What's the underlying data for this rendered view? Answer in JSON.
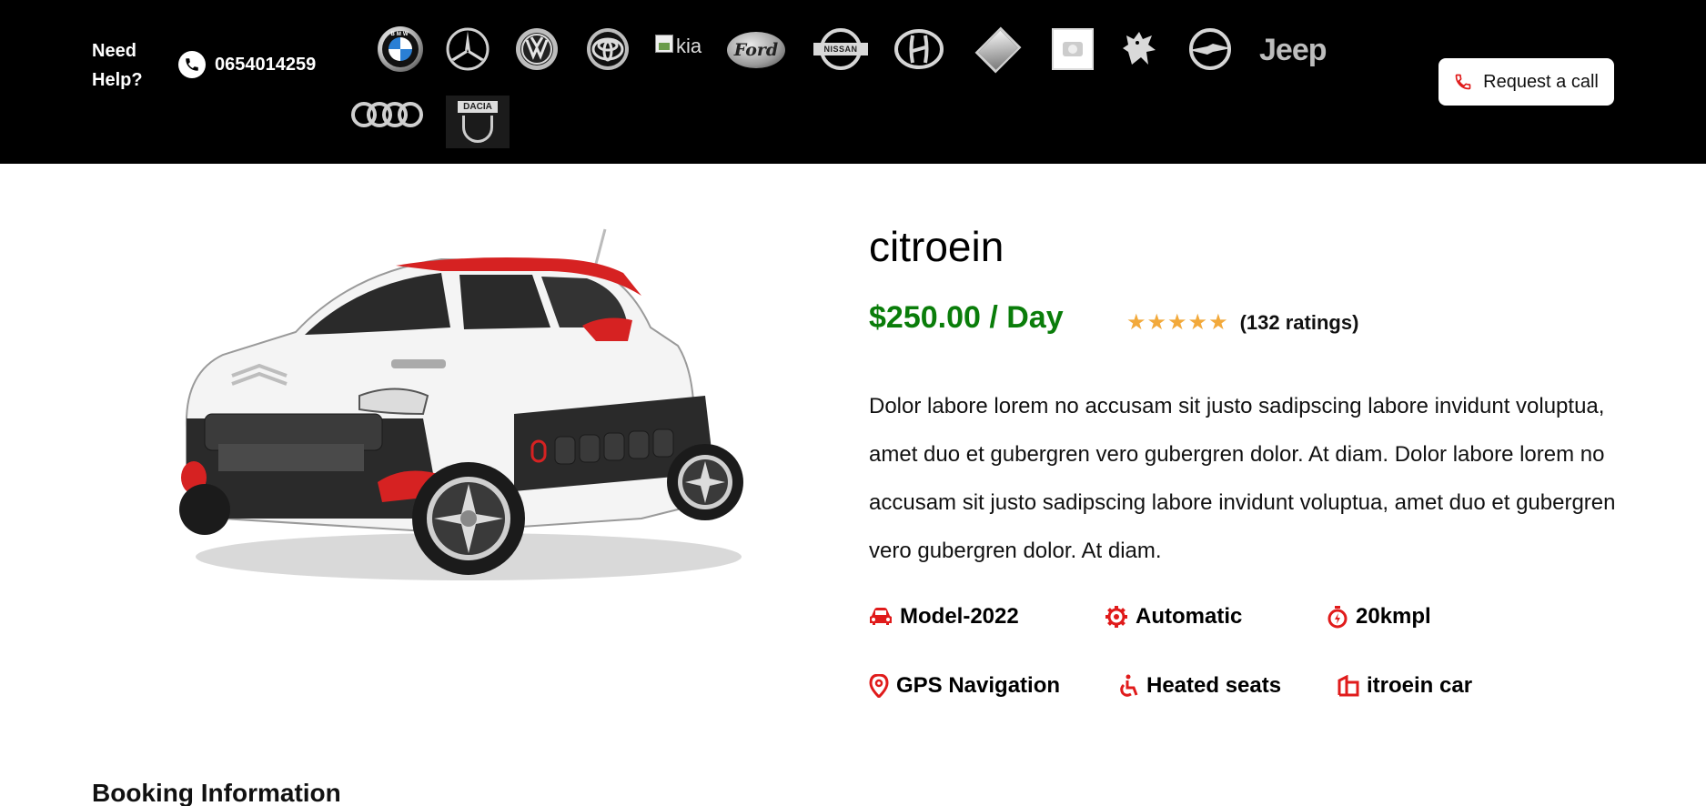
{
  "header": {
    "help_text": "Need Help?",
    "phone": "0654014259",
    "request_label": "Request a call",
    "brand_logos": [
      "BMW",
      "Mercedes-Benz",
      "Volkswagen",
      "Toyota",
      "Kia",
      "Ford",
      "Nissan",
      "Hyundai",
      "Renault",
      "Image placeholder",
      "Peugeot",
      "Opel",
      "Jeep",
      "Audi",
      "Dacia"
    ],
    "kia_alt": "kia",
    "bmw_text": "BMW",
    "ford_text": "Ford",
    "nissan_text": "NISSAN",
    "jeep_text": "Jeep",
    "dacia_text": "DACIA"
  },
  "product": {
    "title": "citroein",
    "price": "$250.00 / Day",
    "stars": "★★★★★",
    "rating_value": 5,
    "rating_count": "(132 ratings)",
    "description": "Dolor labore lorem no accusam sit justo sadipscing labore invidunt voluptua, amet duo et gubergren vero gubergren dolor. At diam. Dolor labore lorem no accusam sit justo sadipscing labore invidunt voluptua, amet duo et gubergren vero gubergren dolor. At diam.",
    "features": [
      {
        "label": "Model-2022",
        "icon": "car-icon"
      },
      {
        "label": "Automatic",
        "icon": "gear-icon"
      },
      {
        "label": "20kmpl",
        "icon": "stopwatch-icon"
      },
      {
        "label": "GPS Navigation",
        "icon": "map-pin-icon"
      },
      {
        "label": "Heated seats",
        "icon": "wheelchair-icon"
      },
      {
        "label": "itroein car",
        "icon": "building-icon"
      }
    ]
  },
  "booking": {
    "heading": "Booking Information"
  },
  "colors": {
    "topbar": "#000000",
    "accent_red": "#e01b1b",
    "price_green": "#0a7d0a",
    "star": "#f2a93b"
  }
}
